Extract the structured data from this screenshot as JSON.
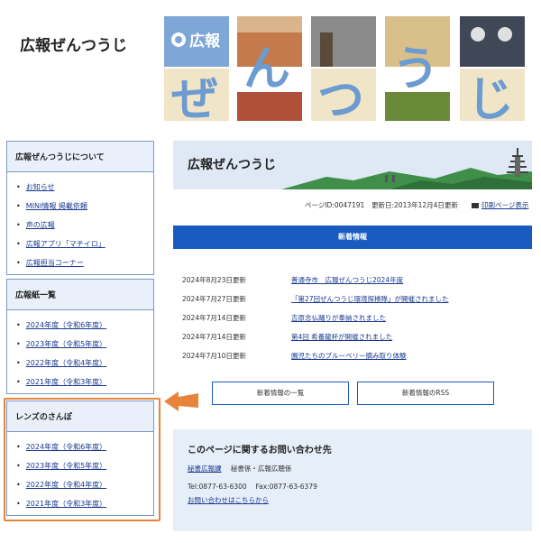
{
  "header": {
    "site_title": "広報ぜんつうじ",
    "banner_logo": "広報",
    "banner_chars": [
      "ぜ",
      "ん",
      "つ",
      "う",
      "じ"
    ]
  },
  "sidebar": {
    "about": {
      "heading": "広報ぜんつうじについて",
      "items": [
        "お知らせ",
        "MINI情報 掲載依頼",
        "声の広報",
        "広報アプリ「マチイロ」",
        "広報担当コーナー"
      ]
    },
    "issues": {
      "heading": "広報紙一覧",
      "items": [
        "2024年度（令和6年度）",
        "2023年度（令和5年度）",
        "2022年度（令和4年度）",
        "2021年度（令和3年度）"
      ]
    },
    "lens": {
      "heading": "レンズのさんぽ",
      "items": [
        "2024年度（令和6年度）",
        "2023年度（令和5年度）",
        "2022年度（令和4年度）",
        "2021年度（令和3年度）"
      ]
    }
  },
  "main": {
    "page_title": "広報ぜんつうじ",
    "page_id": "ページID:0047191",
    "updated": "更新日:2013年12月4日更新",
    "print": "印刷ページ表示",
    "new_heading": "新着情報",
    "news": [
      {
        "date": "2024年8月23日更新",
        "title": "善通寺市　広報ぜんつうじ2024年度"
      },
      {
        "date": "2024年7月27日更新",
        "title": "「第27回ぜんつうじ環境探検隊」が開催されました"
      },
      {
        "date": "2024年7月14日更新",
        "title": "吉原念仏踊りが奉納されました"
      },
      {
        "date": "2024年7月14日更新",
        "title": "第4回 希養龍杯が開催されました"
      },
      {
        "date": "2024年7月10日更新",
        "title": "園児たちのブルーベリー摘み取り体験"
      }
    ],
    "buttons": {
      "list": "新着情報の一覧",
      "rss": "新着情報のRSS"
    }
  },
  "contact": {
    "title": "このページに関するお問い合わせ先",
    "dept": "秘書広報課",
    "section": "秘書係・広報広聴係",
    "tel": "Tel:0877-63-6300　 Fax:0877-63-6379",
    "form": "お問い合わせはこちらから"
  },
  "colors": {
    "accent": "#1a5bbf",
    "highlight": "#e8843a",
    "box_bg": "#e9f0fa"
  }
}
